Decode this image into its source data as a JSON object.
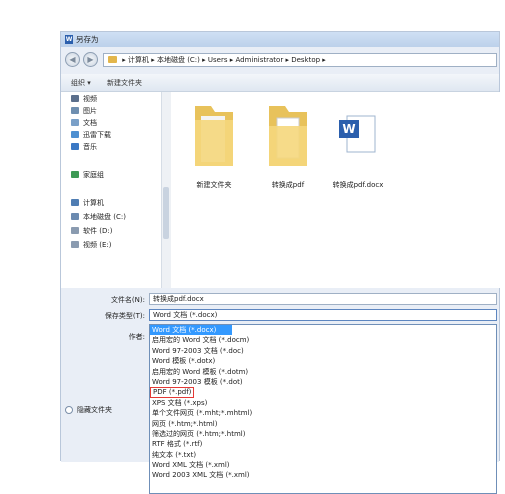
{
  "window": {
    "title": "另存为"
  },
  "address": {
    "parts": [
      "计算机",
      "本地磁盘 (C:)",
      "Users",
      "Administrator",
      "Desktop"
    ],
    "separator": "▸"
  },
  "toolbar": {
    "organize": "组织 ▾",
    "new_folder": "新建文件夹"
  },
  "sidebar": {
    "items": [
      {
        "label": "视频",
        "color": "#5b6f8c"
      },
      {
        "label": "图片",
        "color": "#6f8fb0"
      },
      {
        "label": "文档",
        "color": "#7aa0c8"
      },
      {
        "label": "迅雷下载",
        "color": "#4d8fd1"
      },
      {
        "label": "音乐",
        "color": "#3a78c4"
      },
      {
        "label": "家庭组",
        "color": "#3d9a55"
      },
      {
        "label": "计算机",
        "color": "#4f7db3"
      },
      {
        "label": "本地磁盘 (C:)",
        "color": "#6b8ab0"
      },
      {
        "label": "软件 (D:)",
        "color": "#8a9bb0"
      },
      {
        "label": "视频 (E:)",
        "color": "#8a9bb0"
      }
    ]
  },
  "files": [
    {
      "name": "新建文件夹",
      "type": "folder"
    },
    {
      "name": "转换成pdf",
      "type": "folder"
    },
    {
      "name": "转换成pdf.docx",
      "type": "word"
    }
  ],
  "form": {
    "filename_label": "文件名(N):",
    "filename_value": "转换成pdf.docx",
    "savetype_label": "保存类型(T):",
    "savetype_value": "Word 文档 (*.docx)",
    "author_label": "作者:"
  },
  "dropdown": {
    "options": [
      "Word 文档 (*.docx)",
      "启用宏的 Word 文档 (*.docm)",
      "Word 97-2003 文档 (*.doc)",
      "Word 模板 (*.dotx)",
      "启用宏的 Word 模板 (*.dotm)",
      "Word 97-2003 模板 (*.dot)",
      "PDF (*.pdf)",
      "XPS 文档 (*.xps)",
      "单个文件网页 (*.mht;*.mhtml)",
      "网页 (*.htm;*.html)",
      "筛选过的网页 (*.htm;*.html)",
      "RTF 格式 (*.rtf)",
      "纯文本 (*.txt)",
      "Word XML 文档 (*.xml)",
      "Word 2003 XML 文档 (*.xml)"
    ],
    "selected_index": 0,
    "highlighted_index": 6
  },
  "hide_folders": "隐藏文件夹",
  "colors": {
    "selection": "#3399ff",
    "highlight_box": "#e53935"
  }
}
